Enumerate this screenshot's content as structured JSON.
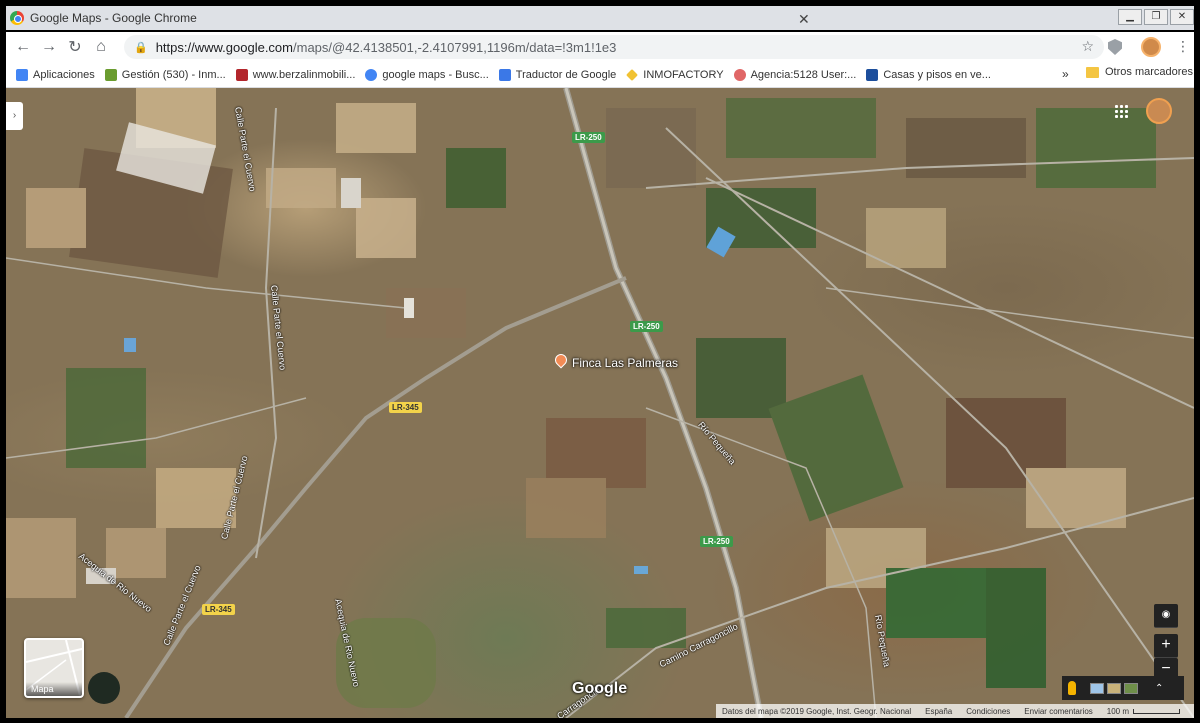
{
  "browser": {
    "window_title": "Google Maps - Google Chrome",
    "url_host": "https://www.google.com",
    "url_path": "/maps/@42.4138501,-2.4107991,1196m/data=!3m1!1e3",
    "bookmarks": [
      {
        "label": "Aplicaciones",
        "icon": "apps-grid-icon",
        "color": "#4285f4"
      },
      {
        "label": "Gestión (530) - Inm...",
        "icon": "id-icon",
        "color": "#6a9c2f"
      },
      {
        "label": "www.berzalinmobili...",
        "icon": "house-icon",
        "color": "#b3262c"
      },
      {
        "label": "google maps - Busc...",
        "icon": "google-g-icon",
        "color": "#4285f4"
      },
      {
        "label": "Traductor de Google",
        "icon": "translate-icon",
        "color": "#3b78e7"
      },
      {
        "label": "INMOFACTORY",
        "icon": "diamond-icon",
        "color": "#f1c232"
      },
      {
        "label": "Agencia:5128 User:...",
        "icon": "flower-icon",
        "color": "#e06666"
      },
      {
        "label": "Casas y pisos en ve...",
        "icon": "p-icon",
        "color": "#1c4e9c"
      }
    ],
    "bookmarks_more": "»",
    "other_bookmarks": "Otros marcadores"
  },
  "map": {
    "place_name": "Finca Las Palmeras",
    "road_labels": {
      "lr250_a": "LR-250",
      "lr250_b": "LR-250",
      "lr250_c": "LR-250",
      "lr345_a": "LR-345",
      "lr345_b": "LR-345"
    },
    "street_names": {
      "calle_parte_cuervo_1": "Calle Parte el Cuervo",
      "calle_parte_cuervo_2": "Calle Parte el Cuervo",
      "calle_parte_cuervo_3": "Calle Parte el Cuervo",
      "calle_parte_cuervo_4": "Calle Parte el Cuervo",
      "acequia_1": "Acequia de Rio Nuevo",
      "acequia_2": "Acequia de Rio Nuevo",
      "rio_pequena_1": "Río Pequeña",
      "rio_pequena_2": "Río Pequeña",
      "camino_carragoncillo": "Camino Carragoncillo",
      "carragoncillo_2": "Carragoncillo"
    },
    "layer_switch_label": "Mapa",
    "google_logo": "Google",
    "footer": {
      "data": "Datos del mapa ©2019 Google, Inst. Geogr. Nacional",
      "country": "España",
      "terms": "Condiciones",
      "feedback": "Enviar comentarios",
      "scale": "100 m"
    },
    "controls": {
      "zoom_in": "+",
      "zoom_out": "−",
      "locate": "◉",
      "expand": "⌃"
    }
  }
}
